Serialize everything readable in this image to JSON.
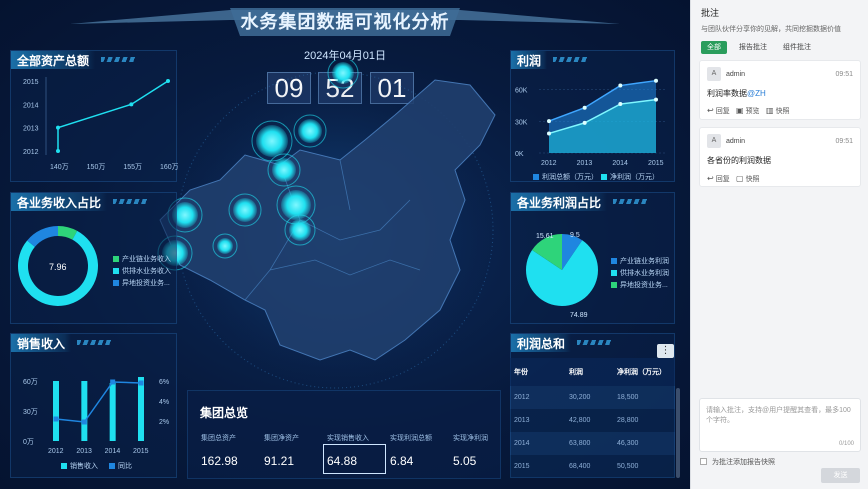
{
  "dashboard": {
    "title": "水务集团数据可视化分析",
    "date": "2024年04月01日",
    "clock": [
      "09",
      "52",
      "01"
    ]
  },
  "panels": {
    "total_assets": "全部资产总额",
    "profit": "利润",
    "business_income_share": "各业务收入占比",
    "business_profit_share": "各业务利润占比",
    "sales_income": "销售收入",
    "profit_total": "利润总和"
  },
  "chart_data": [
    {
      "id": "total-assets",
      "type": "line",
      "title": "全部资产总额",
      "x": [
        "140万",
        "150万",
        "155万",
        "160万"
      ],
      "y_categories": [
        "2012",
        "2013",
        "2014",
        "2015"
      ],
      "points": [
        {
          "x": "140万",
          "y": "2012"
        },
        {
          "x": "140万",
          "y": "2013"
        },
        {
          "x": "155万",
          "y": "2014"
        },
        {
          "x": "160万",
          "y": "2015"
        }
      ]
    },
    {
      "id": "profit",
      "type": "area",
      "title": "利润",
      "categories": [
        "2012",
        "2013",
        "2014",
        "2015"
      ],
      "yticks": [
        "0K",
        "30K",
        "60K"
      ],
      "ylim": [
        0,
        70000
      ],
      "series": [
        {
          "name": "利润总额（万元）",
          "values": [
            30200,
            42800,
            63800,
            68400
          ]
        },
        {
          "name": "净利润（万元）",
          "values": [
            18500,
            28500,
            46300,
            50500
          ]
        }
      ]
    },
    {
      "id": "business-income",
      "type": "pie",
      "title": "各业务收入占比",
      "center_label": "7.96",
      "slices": [
        {
          "name": "产业链业务收入",
          "value": 7.96,
          "color": "#2ed47a"
        },
        {
          "name": "供排水业务收入",
          "value": 78,
          "color": "#1fe0f0"
        },
        {
          "name": "异地投资业务...",
          "value": 14,
          "color": "#1f86e0"
        }
      ]
    },
    {
      "id": "business-profit",
      "type": "pie",
      "title": "各业务利润占比",
      "labels": [
        "15.61",
        "9.5",
        "74.89"
      ],
      "slices": [
        {
          "name": "产业链业务利润",
          "value": 9.5,
          "color": "#1f86e0"
        },
        {
          "name": "供排水业务利润",
          "value": 74.89,
          "color": "#1fe0f0"
        },
        {
          "name": "异地投资业务...",
          "value": 15.61,
          "color": "#2ed47a"
        }
      ]
    },
    {
      "id": "sales-income",
      "type": "bar",
      "title": "销售收入",
      "categories": [
        "2012",
        "2013",
        "2014",
        "2015"
      ],
      "left_ticks": [
        "0万",
        "30万",
        "60万"
      ],
      "right_ticks": [
        "2%",
        "4%",
        "6%"
      ],
      "series": [
        {
          "name": "销售收入",
          "values": [
            60,
            60,
            58,
            64
          ]
        },
        {
          "name": "同比",
          "values": [
            2.2,
            1.9,
            5.9,
            5.8
          ]
        }
      ]
    }
  ],
  "legends": {
    "income": [
      "产业链业务收入",
      "供排水业务收入",
      "异地投资业务..."
    ],
    "profit_share": [
      "产业链业务利润",
      "供排水业务利润",
      "异地投资业务..."
    ],
    "profit": [
      "利润总额（万元）",
      "净利润（万元）"
    ],
    "sales": [
      "销售收入",
      "同比"
    ]
  },
  "summary": {
    "title": "集团总览",
    "items": [
      {
        "label": "集团总资产",
        "value": "162.98"
      },
      {
        "label": "集团净资产",
        "value": "91.21"
      },
      {
        "label": "实现销售收入",
        "value": "64.88"
      },
      {
        "label": "实现利润总额",
        "value": "6.84"
      },
      {
        "label": "实现净利润",
        "value": "5.05"
      }
    ]
  },
  "profit_table": {
    "headers": [
      "年份",
      "利润",
      "净利润（万元）"
    ],
    "rows": [
      [
        "2012",
        "30,200",
        "18,500"
      ],
      [
        "2013",
        "42,800",
        "28,800"
      ],
      [
        "2014",
        "63,800",
        "46,300"
      ],
      [
        "2015",
        "68,400",
        "50,500"
      ]
    ]
  },
  "comment_pane": {
    "title": "批注",
    "subtitle": "与团队伙伴分享你的见解，共同挖掘数据价值",
    "tabs": [
      "全部",
      "报告批注",
      "组件批注"
    ],
    "comments": [
      {
        "avatar": "A",
        "author": "admin",
        "time": "09:51",
        "text": "利润率数据",
        "mention": "@ZH",
        "actions": [
          "回复",
          "预览",
          "快照"
        ]
      },
      {
        "avatar": "A",
        "author": "admin",
        "time": "09:51",
        "text": "各省份的利润数据",
        "actions": [
          "回复",
          "快照"
        ]
      }
    ],
    "input_placeholder": "请输入批注，支持@用户提醒其查看，最多100个字符。",
    "counter": "0/100",
    "checkbox_label": "为批注添加报告快照",
    "send_label": "发送"
  },
  "colors": {
    "accent_cyan": "#1fe0f0",
    "accent_blue": "#1f86e0",
    "accent_green": "#2ed47a",
    "pane_green": "#2a9d5c"
  }
}
